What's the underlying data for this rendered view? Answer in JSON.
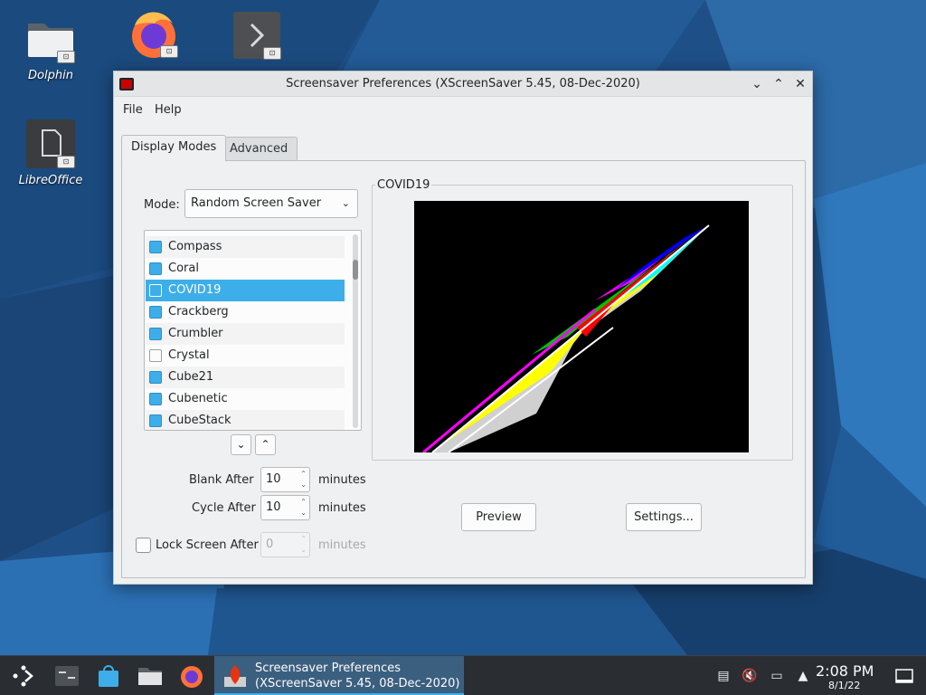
{
  "desktop": {
    "icons": [
      {
        "label": "Dolphin"
      },
      {
        "label": ""
      },
      {
        "label": ""
      },
      {
        "label": "LibreOffice"
      }
    ],
    "link_badge": "⊡"
  },
  "window": {
    "title": "Screensaver Preferences (XScreenSaver 5.45, 08-Dec-2020)",
    "controls": {
      "minimize": "⌄",
      "maximize": "⌃",
      "close": "✕"
    },
    "menu": {
      "file": "File",
      "help": "Help"
    },
    "tabs": {
      "display_modes": "Display Modes",
      "advanced": "Advanced"
    },
    "mode": {
      "label": "Mode:",
      "value": "Random Screen Saver",
      "chevron": "⌄"
    },
    "list": {
      "items": [
        {
          "label": "Compass",
          "checked": true
        },
        {
          "label": "Coral",
          "checked": true
        },
        {
          "label": "COVID19",
          "checked": true,
          "selected": true
        },
        {
          "label": "Crackberg",
          "checked": true
        },
        {
          "label": "Crumbler",
          "checked": true
        },
        {
          "label": "Crystal",
          "checked": false
        },
        {
          "label": "Cube21",
          "checked": true
        },
        {
          "label": "Cubenetic",
          "checked": true
        },
        {
          "label": "CubeStack",
          "checked": true
        }
      ]
    },
    "move_down": "⌄",
    "move_up": "⌃",
    "blank_after": {
      "label": "Blank After",
      "value": "10",
      "unit": "minutes"
    },
    "cycle_after": {
      "label": "Cycle After",
      "value": "10",
      "unit": "minutes"
    },
    "lock_screen": {
      "label": "Lock Screen After",
      "value": "0",
      "unit": "minutes",
      "checked": false
    },
    "spin_arrows": "⌃\n⌄",
    "preview_group": {
      "title": "COVID19"
    },
    "buttons": {
      "preview": "Preview",
      "settings": "Settings..."
    }
  },
  "taskbar": {
    "task": {
      "line1": "Screensaver Preferences",
      "line2": "(XScreenSaver 5.45, 08-Dec-2020)"
    },
    "tray": {
      "clipboard": "▤",
      "volume": "🔇",
      "network": "▭",
      "expand": "▲"
    },
    "clock": {
      "time": "2:08 PM",
      "date": "8/1/22"
    }
  },
  "colors": {
    "accent": "#3daee9",
    "taskbar": "#2a2e32",
    "window_bg": "#eff0f1"
  }
}
